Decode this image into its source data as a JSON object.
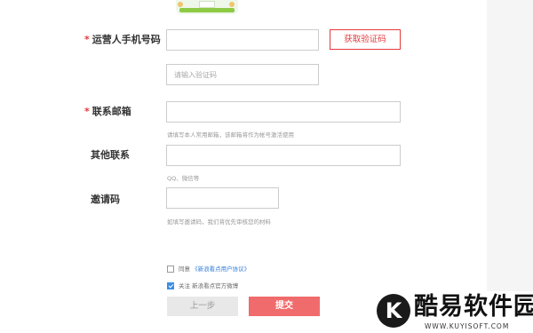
{
  "form": {
    "phone_label": "运营人手机号码",
    "get_code_label": "获取验证码",
    "code_placeholder": "请输入验证码",
    "email_label": "联系邮箱",
    "email_hint": "请填写本人常用邮箱，该邮箱将作为帐号激活使用",
    "other_label": "其他联系",
    "other_hint": "QQ、微信等",
    "invite_label": "邀请码",
    "invite_hint": "如填写邀请码，我们将优先审核您的材料",
    "required_mark": "*"
  },
  "agreements": {
    "agree_prefix": "同意",
    "agree_link": "《新浪看点用户协议》",
    "agree_checked": false,
    "follow_text": "关注 新浪看点官方微博",
    "follow_checked": true
  },
  "actions": {
    "prev_label": "上一步",
    "submit_label": "提交"
  },
  "watermark": {
    "brand": "酷易软件园",
    "url": "WWW.KUYISOFT.COM",
    "logo_letter": "K"
  },
  "colors": {
    "accent_red": "#e4393c",
    "submit_bg": "#f06b6b",
    "link_blue": "#2f7bd9"
  }
}
